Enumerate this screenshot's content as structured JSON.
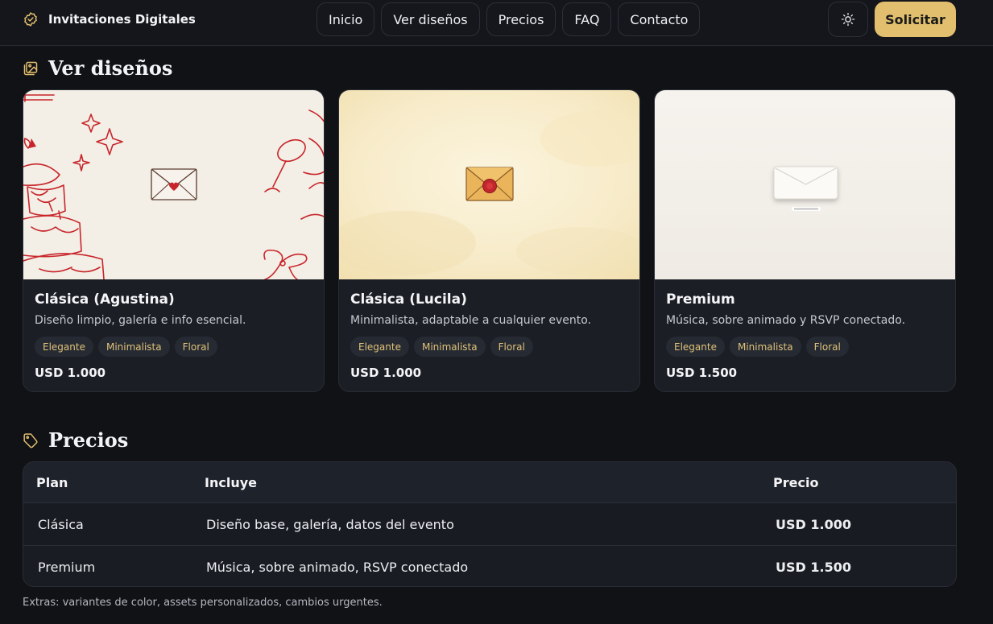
{
  "header": {
    "brand": "Invitaciones Digitales",
    "nav": [
      "Inicio",
      "Ver diseños",
      "Precios",
      "FAQ",
      "Contacto"
    ],
    "cta": "Solicitar",
    "theme_icon": "sun-icon",
    "brand_icon": "badge-check-icon"
  },
  "designs": {
    "title": "Ver diseños",
    "icon": "image-gallery-icon",
    "cards": [
      {
        "title": "Clásica (Agustina)",
        "description": "Diseño limpio, galería e info esencial.",
        "tags": [
          "Elegante",
          "Minimalista",
          "Floral"
        ],
        "price": "USD 1.000"
      },
      {
        "title": "Clásica (Lucila)",
        "description": "Minimalista, adaptable a cualquier evento.",
        "tags": [
          "Elegante",
          "Minimalista",
          "Floral"
        ],
        "price": "USD 1.000"
      },
      {
        "title": "Premium",
        "description": "Música, sobre animado y RSVP conectado.",
        "tags": [
          "Elegante",
          "Minimalista",
          "Floral"
        ],
        "price": "USD 1.500"
      }
    ]
  },
  "pricing": {
    "title": "Precios",
    "icon": "tag-icon",
    "columns": [
      "Plan",
      "Incluye",
      "Precio"
    ],
    "rows": [
      {
        "plan": "Clásica",
        "includes": "Diseño base, galería, datos del evento",
        "price": "USD 1.000"
      },
      {
        "plan": "Premium",
        "includes": "Música, sobre animado, RSVP conectado",
        "price": "USD 1.500"
      }
    ],
    "extras": "Extras: variantes de color, assets personalizados, cambios urgentes."
  },
  "colors": {
    "background": "#101216",
    "accent": "#e2bf6e",
    "card": "#1b1e25",
    "illustration_red": "#c8252b"
  }
}
